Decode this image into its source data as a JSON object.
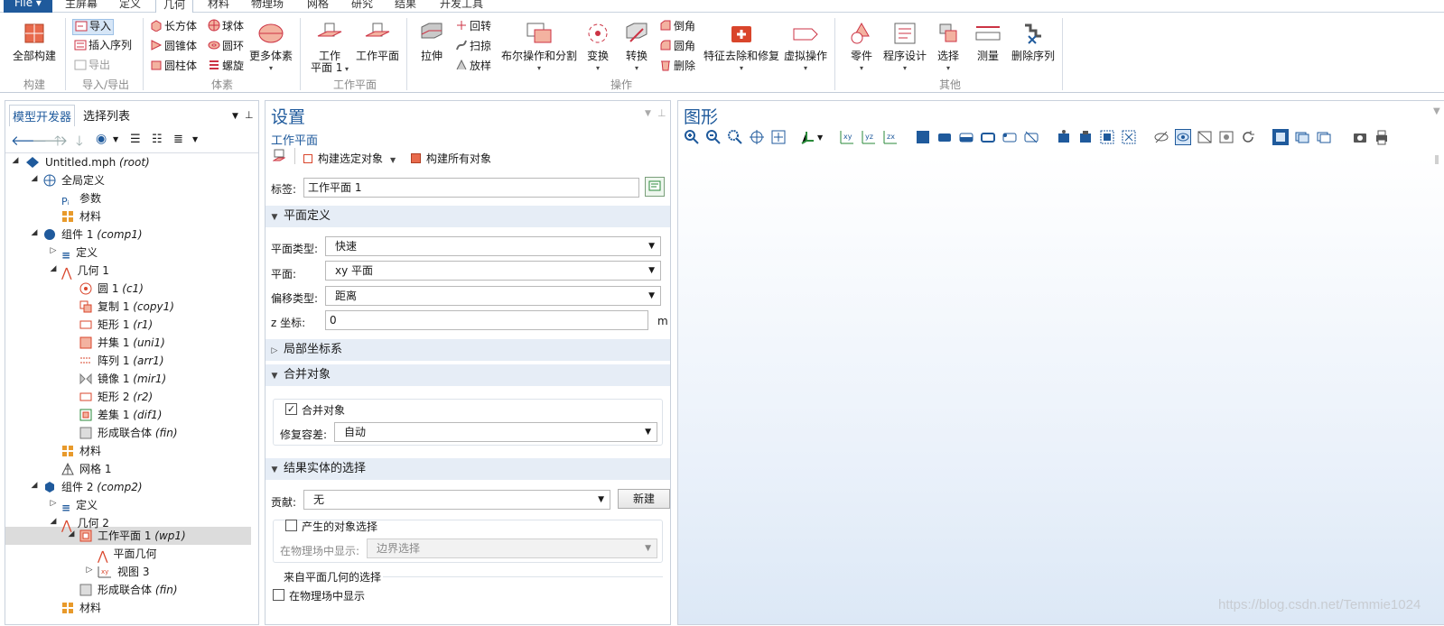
{
  "menu": {
    "file_label": "File ▾",
    "tabs": [
      "主屏幕",
      "定义",
      "几何",
      "材料",
      "物理场",
      "网格",
      "研究",
      "结果",
      "开发工具"
    ],
    "active_tab": "几何"
  },
  "ribbon": {
    "build": {
      "build_all": "全部构建",
      "group": "构建"
    },
    "import": {
      "import": "导入",
      "insert_sequence": "插入序列",
      "export": "导出",
      "group": "导入/导出"
    },
    "primitives": {
      "block": "长方体",
      "sphere": "球体",
      "cone": "圆锥体",
      "torus": "圆环",
      "cylinder": "圆柱体",
      "helix": "螺旋",
      "more": "更多体素",
      "group": "体素"
    },
    "workplane": {
      "work_plane": "工作",
      "work_plane2": "平面 1",
      "work_plane_btn": "工作平面",
      "group": "工作平面"
    },
    "operations": {
      "extrude": "拉伸",
      "revolve": "回转",
      "sweep": "扫掠",
      "loft": "放样",
      "boolean": "布尔操作和分割",
      "transform": "变换",
      "convert": "转换",
      "chamfer": "倒角",
      "fillet": "圆角",
      "delete": "删除",
      "defeaturing": "特征去除和修复",
      "virtual": "虚拟操作",
      "group": "操作"
    },
    "other": {
      "parts": "零件",
      "programming": "程序设计",
      "selections": "选择",
      "measure": "测量",
      "delete_sequence": "删除序列",
      "group": "其他"
    }
  },
  "left_panel": {
    "tabs": [
      "模型开发器",
      "选择列表"
    ],
    "tree": [
      {
        "label": "Untitled.mph",
        "tag": "(root)",
        "icon": "model-icon"
      },
      {
        "label": "全局定义",
        "tag": "",
        "icon": "globe-icon"
      },
      {
        "label": "参数",
        "tag": "",
        "icon": "parameters-icon"
      },
      {
        "label": "材料",
        "tag": "",
        "icon": "materials-icon"
      },
      {
        "label": "组件 1",
        "tag": "(comp1)",
        "icon": "component-icon"
      },
      {
        "label": "定义",
        "tag": "",
        "icon": "definitions-icon"
      },
      {
        "label": "几何 1",
        "tag": "",
        "icon": "geometry-icon"
      },
      {
        "label": "圆 1",
        "tag": "(c1)",
        "icon": "circle-icon"
      },
      {
        "label": "复制 1",
        "tag": "(copy1)",
        "icon": "copy-icon"
      },
      {
        "label": "矩形 1",
        "tag": "(r1)",
        "icon": "rectangle-icon"
      },
      {
        "label": "并集 1",
        "tag": "(uni1)",
        "icon": "union-icon"
      },
      {
        "label": "阵列 1",
        "tag": "(arr1)",
        "icon": "array-icon"
      },
      {
        "label": "镜像 1",
        "tag": "(mir1)",
        "icon": "mirror-icon"
      },
      {
        "label": "矩形 2",
        "tag": "(r2)",
        "icon": "rectangle-icon"
      },
      {
        "label": "差集 1",
        "tag": "(dif1)",
        "icon": "difference-icon"
      },
      {
        "label": "形成联合体",
        "tag": "(fin)",
        "icon": "form-union-icon"
      },
      {
        "label": "材料",
        "tag": "",
        "icon": "materials-icon"
      },
      {
        "label": "网格 1",
        "tag": "",
        "icon": "mesh-icon"
      },
      {
        "label": "组件 2",
        "tag": "(comp2)",
        "icon": "component-3d-icon"
      },
      {
        "label": "定义",
        "tag": "",
        "icon": "definitions-icon"
      },
      {
        "label": "几何 2",
        "tag": "",
        "icon": "geometry-icon"
      },
      {
        "label": "工作平面 1",
        "tag": "(wp1)",
        "icon": "work-plane-icon"
      },
      {
        "label": "平面几何",
        "tag": "",
        "icon": "plane-geometry-icon"
      },
      {
        "label": "视图 3",
        "tag": "",
        "icon": "view-icon"
      },
      {
        "label": "形成联合体",
        "tag": "(fin)",
        "icon": "form-union-icon"
      },
      {
        "label": "材料",
        "tag": "",
        "icon": "materials-icon"
      }
    ]
  },
  "settings": {
    "title": "设置",
    "subtitle": "工作平面",
    "build_selected": "构建选定对象",
    "build_all": "构建所有对象",
    "label_caption": "标签:",
    "label_value": "工作平面 1",
    "plane_definition": {
      "header": "平面定义",
      "plane_type_label": "平面类型:",
      "plane_type_value": "快速",
      "plane_label": "平面:",
      "plane_value": "xy 平面",
      "offset_type_label": "偏移类型:",
      "offset_type_value": "距离",
      "z_label": "z 坐标:",
      "z_value": "0",
      "z_unit": "m"
    },
    "local_coord_header": "局部坐标系",
    "unite_objects": {
      "header": "合并对象",
      "checkbox_label": "合并对象",
      "checked": true,
      "repair_label": "修复容差:",
      "repair_value": "自动"
    },
    "resulting_selection": {
      "header": "结果实体的选择",
      "contribute_label": "贡献:",
      "contribute_value": "无",
      "new_button": "新建",
      "object_selection_label": "产生的对象选择",
      "show_in_physics_label": "在物理场中显示:",
      "show_in_physics_value": "边界选择",
      "from_plane_label": "来自平面几何的选择",
      "show_in_physics_check": "在物理场中显示"
    }
  },
  "graphics": {
    "title": "图形"
  },
  "watermark": "https://blog.csdn.net/Temmie1024"
}
